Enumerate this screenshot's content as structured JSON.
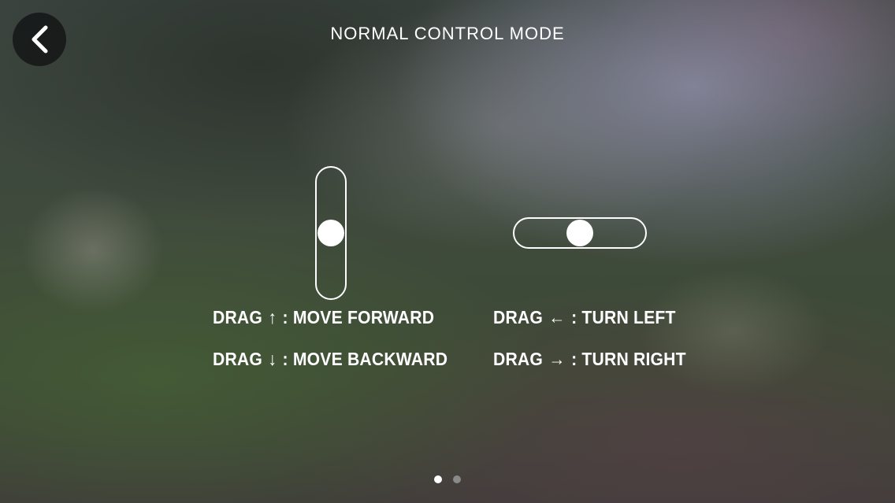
{
  "header": {
    "title": "NORMAL CONTROL MODE",
    "back_icon": "chevron-left-icon"
  },
  "controls": {
    "vertical_slider": {
      "position": 0.5
    },
    "horizontal_slider": {
      "position": 0.5
    }
  },
  "instructions": {
    "forward": {
      "prefix": "DRAG",
      "arrow": "↑",
      "text": ": MOVE FORWARD"
    },
    "backward": {
      "prefix": "DRAG",
      "arrow": "↓",
      "text": ": MOVE BACKWARD"
    },
    "left": {
      "prefix": "DRAG",
      "arrow": "←",
      "text": ": TURN LEFT"
    },
    "right": {
      "prefix": "DRAG",
      "arrow": "→",
      "text": ": TURN RIGHT"
    }
  },
  "pagination": {
    "total": 2,
    "current": 1
  },
  "colors": {
    "foreground": "#ffffff",
    "dot_inactive": "#8a8a8a",
    "button_bg": "#141616"
  }
}
